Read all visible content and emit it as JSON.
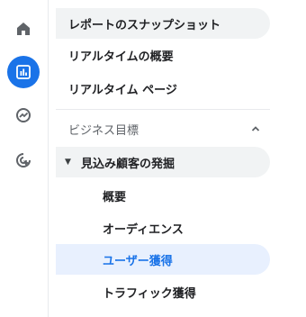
{
  "nav": {
    "snapshot": "レポートのスナップショット",
    "realtime_overview": "リアルタイムの概要",
    "realtime_pages": "リアルタイム ページ"
  },
  "section": {
    "title": "ビジネス目標",
    "collection": "見込み顧客の発掘",
    "items": [
      "概要",
      "オーディエンス",
      "ユーザー獲得",
      "トラフィック獲得"
    ]
  },
  "colors": {
    "accent": "#1a73e8",
    "selected_bg": "#e8f0fe",
    "hover_bg": "#f1f3f4"
  }
}
